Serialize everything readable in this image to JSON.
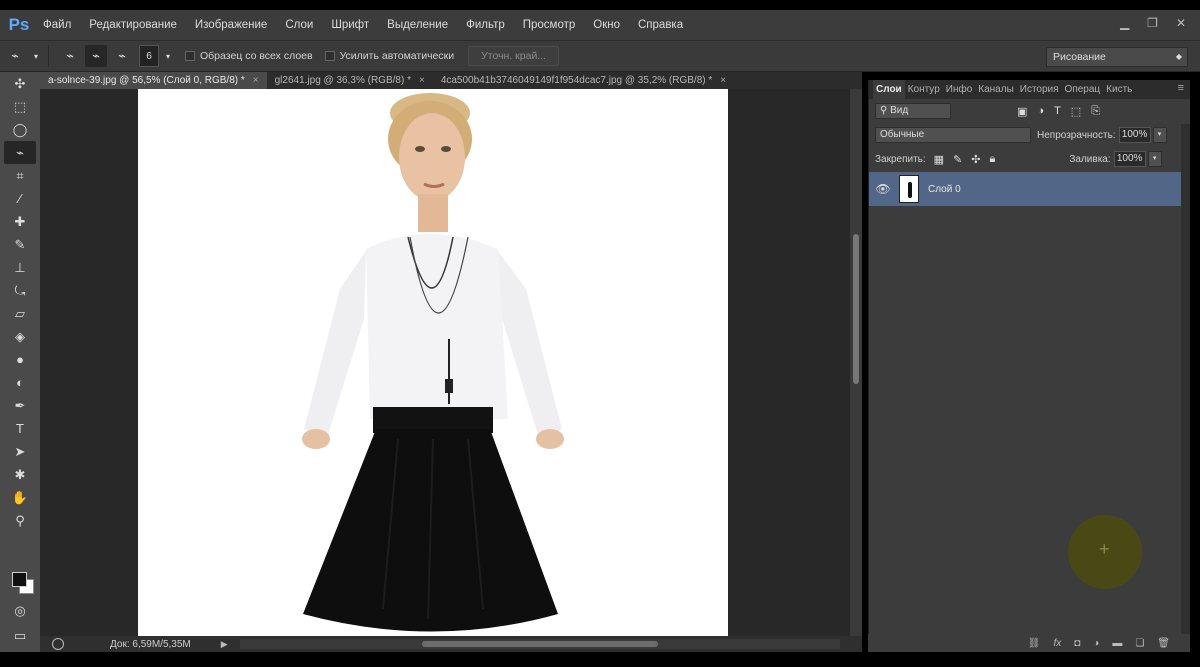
{
  "app": {
    "logo": "Ps"
  },
  "menu": [
    "Файл",
    "Редактирование",
    "Изображение",
    "Слои",
    "Шрифт",
    "Выделение",
    "Фильтр",
    "Просмотр",
    "Окно",
    "Справка"
  ],
  "options": {
    "brush_size": "6",
    "sample_all_layers": "Образец со всех слоев",
    "auto_enhance": "Усилить автоматически",
    "refine_edge": "Уточн. край...",
    "workspace": "Рисование"
  },
  "tabs": [
    {
      "label": "a-solnce-39.jpg @ 56,5% (Слой 0, RGB/8) *",
      "close": "×"
    },
    {
      "label": "gl2641.jpg @ 36,3% (RGB/8) *",
      "close": "×"
    },
    {
      "label": "4ca500b41b3746049149f1f954dcac7.jpg @ 35,2% (RGB/8) *",
      "close": "×"
    }
  ],
  "status": {
    "doc_info": "Док: 6,59M/5,35M"
  },
  "panel": {
    "tabs": [
      "Слои",
      "Контур",
      "Инфо",
      "Каналы",
      "История",
      "Операц",
      "Кисть"
    ],
    "filter": "Вид",
    "blend_mode": "Обычные",
    "opacity_label": "Непрозрачность:",
    "opacity": "100%",
    "lock_label": "Закрепить:",
    "fill_label": "Заливка:",
    "fill": "100%",
    "layers": [
      {
        "name": "Слой 0"
      }
    ]
  }
}
